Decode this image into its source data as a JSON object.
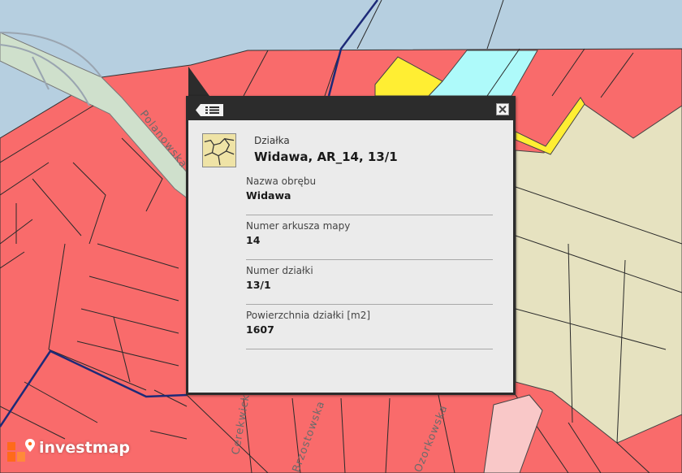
{
  "map": {
    "streets": [
      "Polanowska",
      "Cerekwicka",
      "Brzostowska",
      "Ozorkowska"
    ],
    "colors": {
      "water": "#b6cfe0",
      "parcel": "#f96b6b",
      "highlight_yellow": "#ffee33",
      "highlight_cyan": "#aefafa",
      "area_beige": "#e6e2c0",
      "parcel_pink": "#f9c8c8",
      "boundary_navy": "#1d2a78"
    }
  },
  "popup": {
    "type_label": "Działka",
    "title": "Widawa, AR_14, 13/1",
    "icons": {
      "menu": "list-menu-icon",
      "close": "close-icon",
      "parcel": "parcel-map-icon"
    },
    "fields": [
      {
        "label": "Nazwa obrębu",
        "value": "Widawa"
      },
      {
        "label": "Numer arkusza mapy",
        "value": "14"
      },
      {
        "label": "Numer działki",
        "value": "13/1"
      },
      {
        "label": "Powierzchnia działki [m2]",
        "value": "1607"
      }
    ]
  },
  "brand": {
    "name": "investmap",
    "accent": "#ff6a1a"
  }
}
